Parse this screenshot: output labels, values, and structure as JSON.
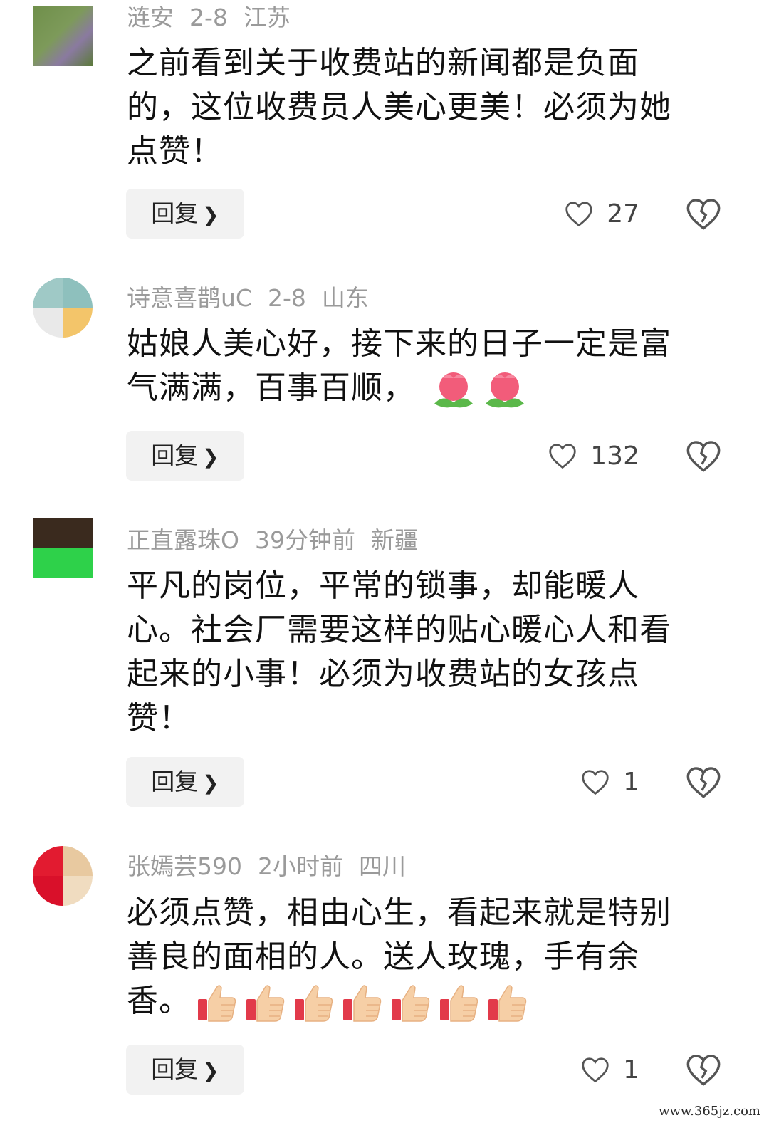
{
  "comments": [
    {
      "username": "涟安",
      "time": "2-8",
      "location": "江苏",
      "lines": [
        "之前看到关于收费站的新闻都是负面",
        "的，这位收费员人美心更美！必须为她",
        "点赞！"
      ],
      "emoji": [],
      "reply_label": "回复",
      "likes": "27"
    },
    {
      "username": "诗意喜鹊uC",
      "time": "2-8",
      "location": "山东",
      "lines": [
        "姑娘人美心好，接下来的日子一定是富",
        "气满满，百事百顺，"
      ],
      "emoji": [
        "tulip-emoji",
        "tulip-emoji"
      ],
      "reply_label": "回复",
      "likes": "132"
    },
    {
      "username": "正直露珠O",
      "time": "39分钟前",
      "location": "新疆",
      "lines": [
        "平凡的岗位，平常的锁事，却能暖人",
        "心。社会厂需要这样的贴心暖心人和看",
        "起来的小事！必须为收费站的女孩点",
        "赞！"
      ],
      "emoji": [],
      "reply_label": "回复",
      "likes": "1"
    },
    {
      "username": "张嫣芸590",
      "time": "2小时前",
      "location": "四川",
      "lines": [
        "必须点赞，相由心生，看起来就是特别",
        "善良的面相的人。送人玫瑰，手有余",
        "香。"
      ],
      "emoji": [
        "thumbs-up-emoji",
        "thumbs-up-emoji",
        "thumbs-up-emoji",
        "thumbs-up-emoji",
        "thumbs-up-emoji",
        "thumbs-up-emoji",
        "thumbs-up-emoji"
      ],
      "reply_label": "回复",
      "likes": "1"
    }
  ],
  "icons": {
    "like": "heart-outline-icon",
    "dislike": "broken-heart-icon",
    "reply_chevron": "chevron-right-icon"
  },
  "watermark": "www.365jz.com"
}
